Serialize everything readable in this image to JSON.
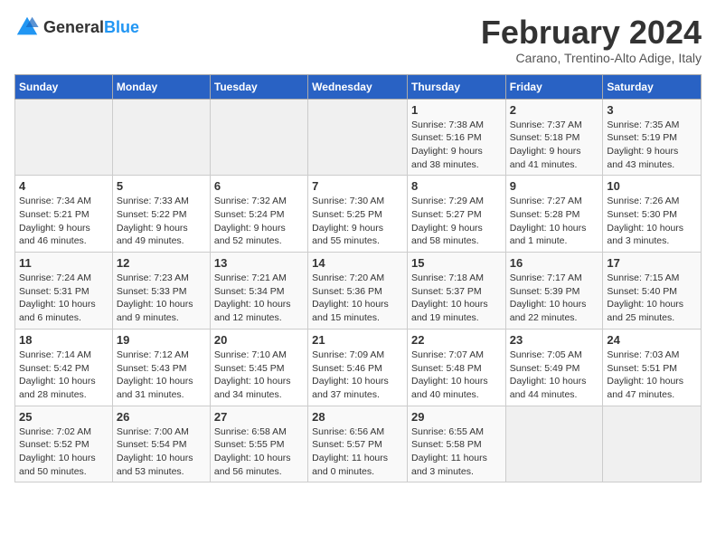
{
  "header": {
    "logo_general": "General",
    "logo_blue": "Blue",
    "month_year": "February 2024",
    "location": "Carano, Trentino-Alto Adige, Italy"
  },
  "days_of_week": [
    "Sunday",
    "Monday",
    "Tuesday",
    "Wednesday",
    "Thursday",
    "Friday",
    "Saturday"
  ],
  "weeks": [
    [
      {
        "day": "",
        "info": ""
      },
      {
        "day": "",
        "info": ""
      },
      {
        "day": "",
        "info": ""
      },
      {
        "day": "",
        "info": ""
      },
      {
        "day": "1",
        "info": "Sunrise: 7:38 AM\nSunset: 5:16 PM\nDaylight: 9 hours\nand 38 minutes."
      },
      {
        "day": "2",
        "info": "Sunrise: 7:37 AM\nSunset: 5:18 PM\nDaylight: 9 hours\nand 41 minutes."
      },
      {
        "day": "3",
        "info": "Sunrise: 7:35 AM\nSunset: 5:19 PM\nDaylight: 9 hours\nand 43 minutes."
      }
    ],
    [
      {
        "day": "4",
        "info": "Sunrise: 7:34 AM\nSunset: 5:21 PM\nDaylight: 9 hours\nand 46 minutes."
      },
      {
        "day": "5",
        "info": "Sunrise: 7:33 AM\nSunset: 5:22 PM\nDaylight: 9 hours\nand 49 minutes."
      },
      {
        "day": "6",
        "info": "Sunrise: 7:32 AM\nSunset: 5:24 PM\nDaylight: 9 hours\nand 52 minutes."
      },
      {
        "day": "7",
        "info": "Sunrise: 7:30 AM\nSunset: 5:25 PM\nDaylight: 9 hours\nand 55 minutes."
      },
      {
        "day": "8",
        "info": "Sunrise: 7:29 AM\nSunset: 5:27 PM\nDaylight: 9 hours\nand 58 minutes."
      },
      {
        "day": "9",
        "info": "Sunrise: 7:27 AM\nSunset: 5:28 PM\nDaylight: 10 hours\nand 1 minute."
      },
      {
        "day": "10",
        "info": "Sunrise: 7:26 AM\nSunset: 5:30 PM\nDaylight: 10 hours\nand 3 minutes."
      }
    ],
    [
      {
        "day": "11",
        "info": "Sunrise: 7:24 AM\nSunset: 5:31 PM\nDaylight: 10 hours\nand 6 minutes."
      },
      {
        "day": "12",
        "info": "Sunrise: 7:23 AM\nSunset: 5:33 PM\nDaylight: 10 hours\nand 9 minutes."
      },
      {
        "day": "13",
        "info": "Sunrise: 7:21 AM\nSunset: 5:34 PM\nDaylight: 10 hours\nand 12 minutes."
      },
      {
        "day": "14",
        "info": "Sunrise: 7:20 AM\nSunset: 5:36 PM\nDaylight: 10 hours\nand 15 minutes."
      },
      {
        "day": "15",
        "info": "Sunrise: 7:18 AM\nSunset: 5:37 PM\nDaylight: 10 hours\nand 19 minutes."
      },
      {
        "day": "16",
        "info": "Sunrise: 7:17 AM\nSunset: 5:39 PM\nDaylight: 10 hours\nand 22 minutes."
      },
      {
        "day": "17",
        "info": "Sunrise: 7:15 AM\nSunset: 5:40 PM\nDaylight: 10 hours\nand 25 minutes."
      }
    ],
    [
      {
        "day": "18",
        "info": "Sunrise: 7:14 AM\nSunset: 5:42 PM\nDaylight: 10 hours\nand 28 minutes."
      },
      {
        "day": "19",
        "info": "Sunrise: 7:12 AM\nSunset: 5:43 PM\nDaylight: 10 hours\nand 31 minutes."
      },
      {
        "day": "20",
        "info": "Sunrise: 7:10 AM\nSunset: 5:45 PM\nDaylight: 10 hours\nand 34 minutes."
      },
      {
        "day": "21",
        "info": "Sunrise: 7:09 AM\nSunset: 5:46 PM\nDaylight: 10 hours\nand 37 minutes."
      },
      {
        "day": "22",
        "info": "Sunrise: 7:07 AM\nSunset: 5:48 PM\nDaylight: 10 hours\nand 40 minutes."
      },
      {
        "day": "23",
        "info": "Sunrise: 7:05 AM\nSunset: 5:49 PM\nDaylight: 10 hours\nand 44 minutes."
      },
      {
        "day": "24",
        "info": "Sunrise: 7:03 AM\nSunset: 5:51 PM\nDaylight: 10 hours\nand 47 minutes."
      }
    ],
    [
      {
        "day": "25",
        "info": "Sunrise: 7:02 AM\nSunset: 5:52 PM\nDaylight: 10 hours\nand 50 minutes."
      },
      {
        "day": "26",
        "info": "Sunrise: 7:00 AM\nSunset: 5:54 PM\nDaylight: 10 hours\nand 53 minutes."
      },
      {
        "day": "27",
        "info": "Sunrise: 6:58 AM\nSunset: 5:55 PM\nDaylight: 10 hours\nand 56 minutes."
      },
      {
        "day": "28",
        "info": "Sunrise: 6:56 AM\nSunset: 5:57 PM\nDaylight: 11 hours\nand 0 minutes."
      },
      {
        "day": "29",
        "info": "Sunrise: 6:55 AM\nSunset: 5:58 PM\nDaylight: 11 hours\nand 3 minutes."
      },
      {
        "day": "",
        "info": ""
      },
      {
        "day": "",
        "info": ""
      }
    ]
  ]
}
